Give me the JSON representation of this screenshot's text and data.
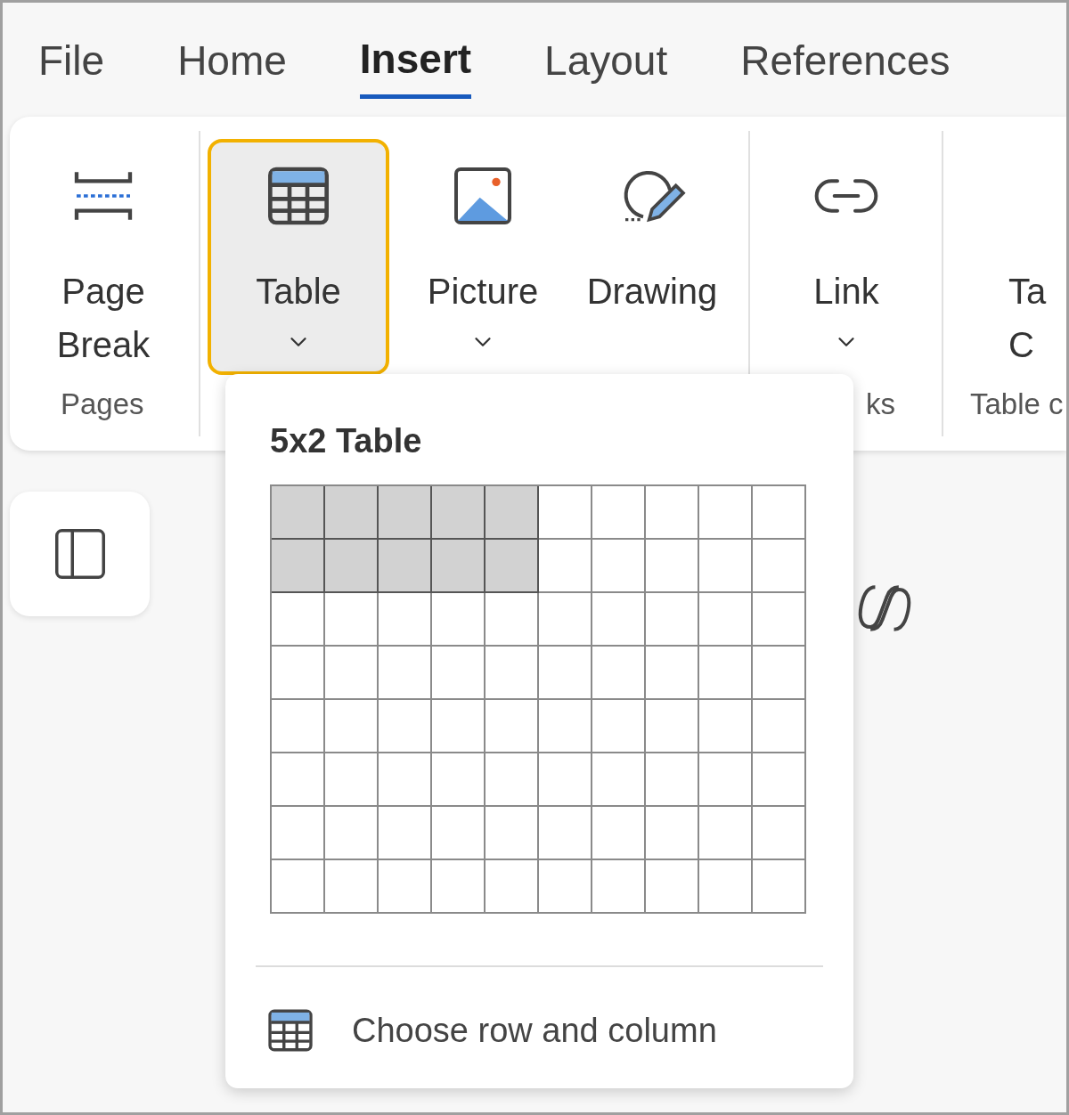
{
  "tabs": [
    {
      "label": "File",
      "selected": false
    },
    {
      "label": "Home",
      "selected": false
    },
    {
      "label": "Insert",
      "selected": true
    },
    {
      "label": "Layout",
      "selected": false
    },
    {
      "label": "References",
      "selected": false
    }
  ],
  "ribbon": {
    "groups": [
      {
        "label": "Pages",
        "items": [
          {
            "kind": "page-break",
            "label": "Page Break",
            "dropdown": false,
            "highlighted": false
          }
        ]
      },
      {
        "items": [
          {
            "kind": "table",
            "label": "Table",
            "dropdown": true,
            "highlighted": true
          },
          {
            "kind": "picture",
            "label": "Picture",
            "dropdown": true,
            "highlighted": false
          },
          {
            "kind": "drawing",
            "label": "Drawing",
            "dropdown": false,
            "highlighted": false
          }
        ]
      },
      {
        "label": "ks",
        "items": [
          {
            "kind": "link",
            "label": "Link",
            "dropdown": true,
            "highlighted": false
          }
        ]
      },
      {
        "label": "Table c",
        "items": [
          {
            "kind": "text",
            "label": "Ta C",
            "dropdown": false,
            "highlighted": false
          }
        ]
      }
    ]
  },
  "table_menu": {
    "title": "5x2 Table",
    "grid": [
      {
        "cells": [
          {
            "selected": true
          },
          {
            "selected": true
          },
          {
            "selected": true
          },
          {
            "selected": true
          },
          {
            "selected": true
          },
          {
            "selected": false
          },
          {
            "selected": false
          },
          {
            "selected": false
          },
          {
            "selected": false
          },
          {
            "selected": false
          }
        ]
      },
      {
        "cells": [
          {
            "selected": true
          },
          {
            "selected": true
          },
          {
            "selected": true
          },
          {
            "selected": true
          },
          {
            "selected": true
          },
          {
            "selected": false
          },
          {
            "selected": false
          },
          {
            "selected": false
          },
          {
            "selected": false
          },
          {
            "selected": false
          }
        ]
      },
      {
        "cells": [
          {
            "selected": false
          },
          {
            "selected": false
          },
          {
            "selected": false
          },
          {
            "selected": false
          },
          {
            "selected": false
          },
          {
            "selected": false
          },
          {
            "selected": false
          },
          {
            "selected": false
          },
          {
            "selected": false
          },
          {
            "selected": false
          }
        ]
      },
      {
        "cells": [
          {
            "selected": false
          },
          {
            "selected": false
          },
          {
            "selected": false
          },
          {
            "selected": false
          },
          {
            "selected": false
          },
          {
            "selected": false
          },
          {
            "selected": false
          },
          {
            "selected": false
          },
          {
            "selected": false
          },
          {
            "selected": false
          }
        ]
      },
      {
        "cells": [
          {
            "selected": false
          },
          {
            "selected": false
          },
          {
            "selected": false
          },
          {
            "selected": false
          },
          {
            "selected": false
          },
          {
            "selected": false
          },
          {
            "selected": false
          },
          {
            "selected": false
          },
          {
            "selected": false
          },
          {
            "selected": false
          }
        ]
      },
      {
        "cells": [
          {
            "selected": false
          },
          {
            "selected": false
          },
          {
            "selected": false
          },
          {
            "selected": false
          },
          {
            "selected": false
          },
          {
            "selected": false
          },
          {
            "selected": false
          },
          {
            "selected": false
          },
          {
            "selected": false
          },
          {
            "selected": false
          }
        ]
      },
      {
        "cells": [
          {
            "selected": false
          },
          {
            "selected": false
          },
          {
            "selected": false
          },
          {
            "selected": false
          },
          {
            "selected": false
          },
          {
            "selected": false
          },
          {
            "selected": false
          },
          {
            "selected": false
          },
          {
            "selected": false
          },
          {
            "selected": false
          }
        ]
      },
      {
        "cells": [
          {
            "selected": false
          },
          {
            "selected": false
          },
          {
            "selected": false
          },
          {
            "selected": false
          },
          {
            "selected": false
          },
          {
            "selected": false
          },
          {
            "selected": false
          },
          {
            "selected": false
          },
          {
            "selected": false
          },
          {
            "selected": false
          }
        ]
      }
    ],
    "menu_item": "Choose row and column"
  }
}
